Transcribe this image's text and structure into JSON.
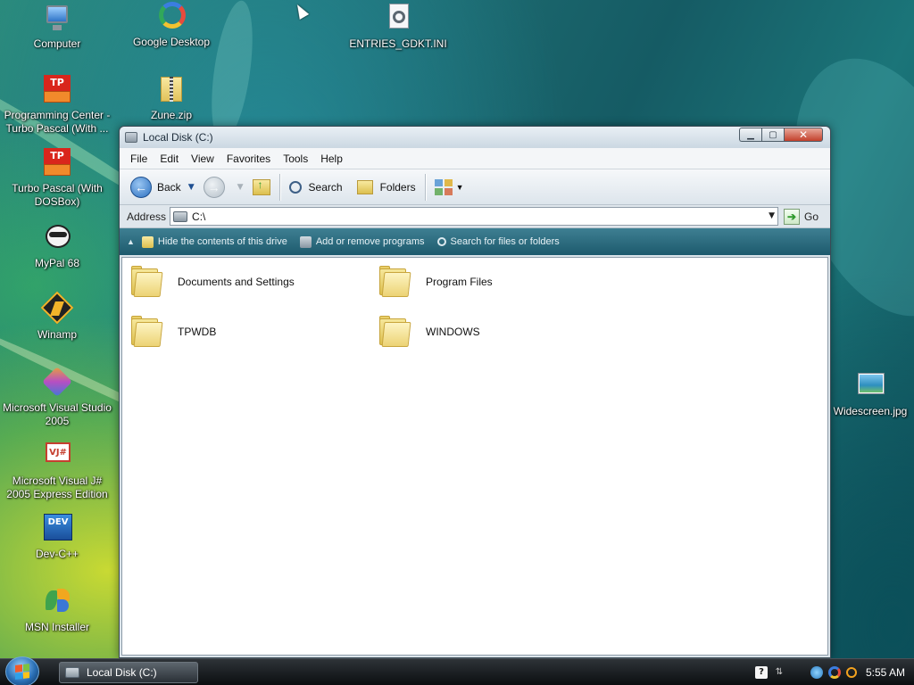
{
  "desktop": {
    "icons": [
      {
        "name": "computer",
        "label": "Computer"
      },
      {
        "name": "google-desktop",
        "label": "Google Desktop"
      },
      {
        "name": "entries-file",
        "label": "ENTRIES_GDKT.INI"
      },
      {
        "name": "programming-center",
        "label": "Programming Center - Turbo Pascal (With ..."
      },
      {
        "name": "zune-zip",
        "label": "Zune.zip"
      },
      {
        "name": "turbo-pascal",
        "label": "Turbo Pascal (With DOSBox)"
      },
      {
        "name": "mypal",
        "label": "MyPal 68"
      },
      {
        "name": "winamp",
        "label": "Winamp"
      },
      {
        "name": "visual-studio",
        "label": "Microsoft Visual Studio 2005"
      },
      {
        "name": "visual-jsharp",
        "label": "Microsoft Visual J# 2005 Express Edition"
      },
      {
        "name": "dev-cpp",
        "label": "Dev-C++"
      },
      {
        "name": "msn-installer",
        "label": "MSN Installer"
      },
      {
        "name": "widescreen-jpg",
        "label": "Widescreen.jpg"
      }
    ]
  },
  "window": {
    "title": "Local Disk (C:)",
    "menu": [
      "File",
      "Edit",
      "View",
      "Favorites",
      "Tools",
      "Help"
    ],
    "toolbar": {
      "back": "Back",
      "search": "Search",
      "folders": "Folders"
    },
    "address": {
      "label": "Address",
      "value": "C:\\",
      "go": "Go"
    },
    "tasks": [
      "Hide the contents of this drive",
      "Add or remove programs",
      "Search for files or folders"
    ],
    "folders": [
      "Documents and Settings",
      "Program Files",
      "TPWDB",
      "WINDOWS"
    ]
  },
  "taskbar": {
    "active_window": "Local Disk (C:)",
    "clock": "5:55 AM"
  },
  "colors": {
    "folder_yellow": "#f3dc80",
    "task_band": "#2b6d80",
    "close_red": "#c3402b"
  }
}
